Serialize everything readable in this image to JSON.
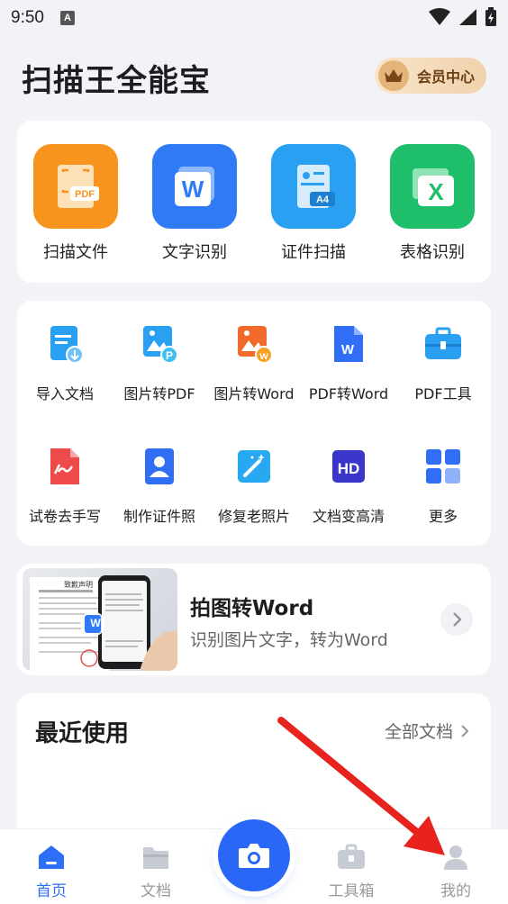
{
  "status_bar": {
    "time": "9:50",
    "notif": "A"
  },
  "header": {
    "title": "扫描王全能宝",
    "vip_label": "会员中心"
  },
  "main_features": [
    {
      "label": "扫描文件",
      "icon": "scan-pdf-icon",
      "color": "#f7941d"
    },
    {
      "label": "文字识别",
      "icon": "word-ocr-icon",
      "color": "#2f7bf5"
    },
    {
      "label": "证件扫描",
      "icon": "id-card-scan-icon",
      "color": "#2aa0f2"
    },
    {
      "label": "表格识别",
      "icon": "excel-ocr-icon",
      "color": "#1fbe6b"
    }
  ],
  "tools": [
    {
      "label": "导入文档",
      "icon": "import-doc-icon"
    },
    {
      "label": "图片转PDF",
      "icon": "image-to-pdf-icon"
    },
    {
      "label": "图片转Word",
      "icon": "image-to-word-icon"
    },
    {
      "label": "PDF转Word",
      "icon": "pdf-to-word-icon"
    },
    {
      "label": "PDF工具",
      "icon": "pdf-tools-icon"
    },
    {
      "label": "试卷去手写",
      "icon": "remove-handwriting-icon"
    },
    {
      "label": "制作证件照",
      "icon": "id-photo-icon"
    },
    {
      "label": "修复老照片",
      "icon": "restore-photo-icon"
    },
    {
      "label": "文档变高清",
      "icon": "hd-doc-icon"
    },
    {
      "label": "更多",
      "icon": "more-grid-icon"
    }
  ],
  "banner": {
    "title": "拍图转Word",
    "subtitle": "识别图片文字，转为Word",
    "doc_title": "致歉声明",
    "badge": "W"
  },
  "recent": {
    "title": "最近使用",
    "all_label": "全部文档"
  },
  "bottom_nav": [
    {
      "label": "首页",
      "icon": "home-icon",
      "active": true
    },
    {
      "label": "文档",
      "icon": "folder-icon",
      "active": false
    },
    {
      "label": "工具箱",
      "icon": "toolbox-icon",
      "active": false
    },
    {
      "label": "我的",
      "icon": "profile-icon",
      "active": false
    }
  ],
  "colors": {
    "accent": "#2b67f6",
    "background": "#f2f3f7",
    "annotation_arrow": "#e8221d"
  }
}
